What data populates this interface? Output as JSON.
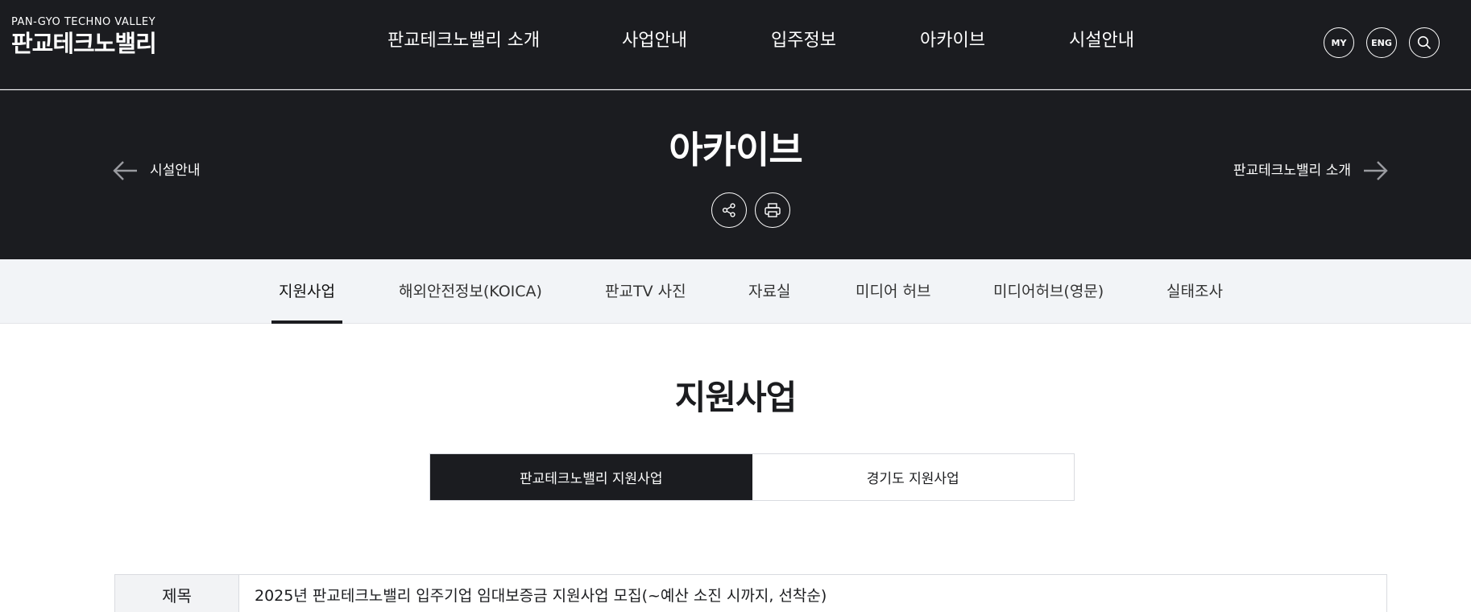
{
  "header": {
    "logo_en": "PAN-GYO TECHNO VALLEY",
    "logo_ko": "판교테크노밸리",
    "nav": [
      "판교테크노밸리 소개",
      "사업안내",
      "입주정보",
      "아카이브",
      "시설안내"
    ],
    "util": {
      "my": "MY",
      "eng": "ENG"
    },
    "search_icon": "search-icon"
  },
  "visual": {
    "title": "아카이브",
    "prev_label": "시설안내",
    "next_label": "판교테크노밸리 소개",
    "share_icon": "share-icon",
    "print_icon": "print-icon"
  },
  "tabs": [
    {
      "label": "지원사업",
      "active": true
    },
    {
      "label": "해외안전정보(KOICA)",
      "active": false
    },
    {
      "label": "판교TV 사진",
      "active": false
    },
    {
      "label": "자료실",
      "active": false
    },
    {
      "label": "미디어 허브",
      "active": false
    },
    {
      "label": "미디어허브(영문)",
      "active": false
    },
    {
      "label": "실태조사",
      "active": false
    }
  ],
  "content": {
    "section_title": "지원사업",
    "segments": [
      {
        "label": "판교테크노밸리 지원사업",
        "selected": true
      },
      {
        "label": "경기도 지원사업",
        "selected": false
      }
    ],
    "table": {
      "subject_header": "제목",
      "subject_value": "2025년 판교테크노밸리 입주기업 임대보증금 지원사업 모집(~예산 소진 시까지, 선착순)"
    }
  },
  "colors": {
    "dark": "#1b1c20",
    "tab_bg": "#f2f4f7",
    "border": "#d9dbe0"
  }
}
